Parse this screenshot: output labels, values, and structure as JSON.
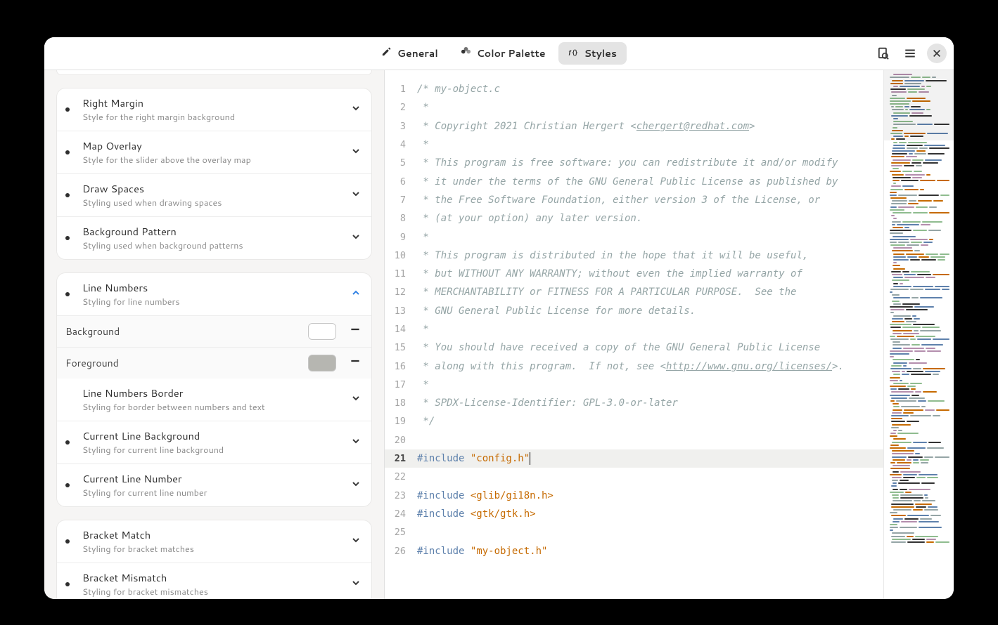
{
  "header": {
    "tabs": [
      {
        "id": "general",
        "label": "General",
        "icon": "pencil-icon"
      },
      {
        "id": "palette",
        "label": "Color Palette",
        "icon": "palette-icon"
      },
      {
        "id": "styles",
        "label": "Styles",
        "icon": "fx-icon"
      }
    ],
    "active_tab": "styles"
  },
  "sidebar": {
    "group1": [
      {
        "title": "Right Margin",
        "sub": "Style for the right margin background",
        "dot": true
      },
      {
        "title": "Map Overlay",
        "sub": "Style for the slider above the overlay map",
        "dot": true
      },
      {
        "title": "Draw Spaces",
        "sub": "Styling used when drawing spaces",
        "dot": true
      },
      {
        "title": "Background Pattern",
        "sub": "Styling used when background patterns",
        "dot": true
      }
    ],
    "group2_header": {
      "title": "Line Numbers",
      "sub": "Styling for line numbers",
      "dot": true
    },
    "group2_props": [
      {
        "label": "Background",
        "color": "#ffffff"
      },
      {
        "label": "Foreground",
        "color": "#b6b6b1"
      }
    ],
    "group2_items": [
      {
        "title": "Line Numbers Border",
        "sub": "Styling for border between numbers and text",
        "dot": false
      },
      {
        "title": "Current Line Background",
        "sub": "Styling for current line background",
        "dot": true
      },
      {
        "title": "Current Line Number",
        "sub": "Styling for current line number",
        "dot": true
      }
    ],
    "group3": [
      {
        "title": "Bracket Match",
        "sub": "Styling for bracket matches",
        "dot": true
      },
      {
        "title": "Bracket Mismatch",
        "sub": "Styling for bracket mismatches",
        "dot": true
      }
    ]
  },
  "editor": {
    "current_line": 21,
    "lines": [
      {
        "n": 1,
        "tokens": [
          {
            "c": "comment",
            "t": "/* my-object.c"
          }
        ]
      },
      {
        "n": 2,
        "tokens": [
          {
            "c": "comment",
            "t": " *"
          }
        ]
      },
      {
        "n": 3,
        "tokens": [
          {
            "c": "comment",
            "t": " * Copyright 2021 Christian Hergert <"
          },
          {
            "c": "link",
            "t": "chergert@redhat.com"
          },
          {
            "c": "comment",
            "t": ">"
          }
        ]
      },
      {
        "n": 4,
        "tokens": [
          {
            "c": "comment",
            "t": " *"
          }
        ]
      },
      {
        "n": 5,
        "tokens": [
          {
            "c": "comment",
            "t": " * This program is free software: you can redistribute it and/or modify"
          }
        ]
      },
      {
        "n": 6,
        "tokens": [
          {
            "c": "comment",
            "t": " * it under the terms of the GNU General Public License as published by"
          }
        ]
      },
      {
        "n": 7,
        "tokens": [
          {
            "c": "comment",
            "t": " * the Free Software Foundation, either version 3 of the License, or"
          }
        ]
      },
      {
        "n": 8,
        "tokens": [
          {
            "c": "comment",
            "t": " * (at your option) any later version."
          }
        ]
      },
      {
        "n": 9,
        "tokens": [
          {
            "c": "comment",
            "t": " *"
          }
        ]
      },
      {
        "n": 10,
        "tokens": [
          {
            "c": "comment",
            "t": " * This program is distributed in the hope that it will be useful,"
          }
        ]
      },
      {
        "n": 11,
        "tokens": [
          {
            "c": "comment",
            "t": " * but WITHOUT ANY WARRANTY; without even the implied warranty of"
          }
        ]
      },
      {
        "n": 12,
        "tokens": [
          {
            "c": "comment",
            "t": " * MERCHANTABILITY or FITNESS FOR A PARTICULAR PURPOSE.  See the"
          }
        ]
      },
      {
        "n": 13,
        "tokens": [
          {
            "c": "comment",
            "t": " * GNU General Public License for more details."
          }
        ]
      },
      {
        "n": 14,
        "tokens": [
          {
            "c": "comment",
            "t": " *"
          }
        ]
      },
      {
        "n": 15,
        "tokens": [
          {
            "c": "comment",
            "t": " * You should have received a copy of the GNU General Public License"
          }
        ]
      },
      {
        "n": 16,
        "tokens": [
          {
            "c": "comment",
            "t": " * along with this program.  If not, see <"
          },
          {
            "c": "link",
            "t": "http://www.gnu.org/licenses/"
          },
          {
            "c": "comment",
            "t": ">."
          }
        ]
      },
      {
        "n": 17,
        "tokens": [
          {
            "c": "comment",
            "t": " *"
          }
        ]
      },
      {
        "n": 18,
        "tokens": [
          {
            "c": "comment",
            "t": " * SPDX-License-Identifier: GPL-3.0-or-later"
          }
        ]
      },
      {
        "n": 19,
        "tokens": [
          {
            "c": "comment",
            "t": " */"
          }
        ]
      },
      {
        "n": 20,
        "tokens": []
      },
      {
        "n": 21,
        "tokens": [
          {
            "c": "keyword",
            "t": "#include "
          },
          {
            "c": "string",
            "t": "\"config.h\""
          }
        ],
        "cursor": true
      },
      {
        "n": 22,
        "tokens": []
      },
      {
        "n": 23,
        "tokens": [
          {
            "c": "keyword",
            "t": "#include "
          },
          {
            "c": "angle",
            "t": "<glib/gi18n.h>"
          }
        ]
      },
      {
        "n": 24,
        "tokens": [
          {
            "c": "keyword",
            "t": "#include "
          },
          {
            "c": "angle",
            "t": "<gtk/gtk.h>"
          }
        ]
      },
      {
        "n": 25,
        "tokens": []
      },
      {
        "n": 26,
        "tokens": [
          {
            "c": "keyword",
            "t": "#include "
          },
          {
            "c": "string",
            "t": "\"my-object.h\""
          }
        ]
      }
    ]
  }
}
